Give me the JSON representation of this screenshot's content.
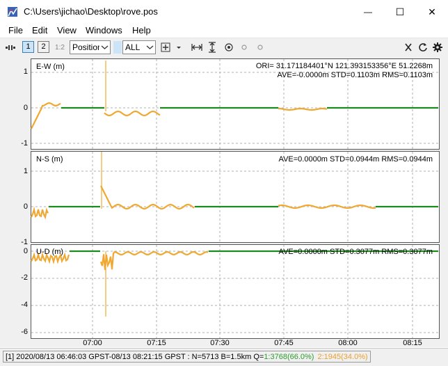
{
  "window": {
    "title": "C:\\Users\\jichao\\Desktop\\rove.pos",
    "minimize_glyph": "—",
    "maximize_glyph": "☐",
    "close_glyph": "✕"
  },
  "menu": [
    "File",
    "Edit",
    "View",
    "Windows",
    "Help"
  ],
  "toolbar": {
    "plot1_label": "1",
    "plot2_label": "2",
    "plot12_label": "1:2",
    "plot_type": "Position",
    "quality_filter": "ALL"
  },
  "panels": [
    {
      "label": "E-W (m)",
      "stats_line1": "ORI= 31.171184401°N  121.393153356°E 51.2268m",
      "stats_line2": "AVE=-0.0000m STD=0.1103m RMS=0.1103m",
      "yticks": [
        "1",
        "0",
        "-1"
      ]
    },
    {
      "label": "N-S (m)",
      "stats_line1": "",
      "stats_line2": "AVE=0.0000m STD=0.0944m RMS=0.0944m",
      "yticks": [
        "1",
        "0",
        "-1"
      ]
    },
    {
      "label": "U-D (m)",
      "stats_line1": "",
      "stats_line2": "AVE=0.0000m STD=0.3077m RMS=0.3077m",
      "yticks": [
        "0",
        "-2",
        "-4",
        "-6"
      ]
    }
  ],
  "xticks": [
    "07:00",
    "07:15",
    "07:30",
    "07:45",
    "08:00",
    "08:15"
  ],
  "status": {
    "text_prefix": "[1] 2020/08/13 06:46:03 GPST-08/13 08:21:15 GPST : N=5713 B=1.5km Q=",
    "fix_text": "1:3768(66.0%)",
    "float_text": "2:1945(34.0%)"
  },
  "colors": {
    "fix": "#1e8a1e",
    "float": "#f0a830",
    "grid": "#b0b0b0"
  }
}
